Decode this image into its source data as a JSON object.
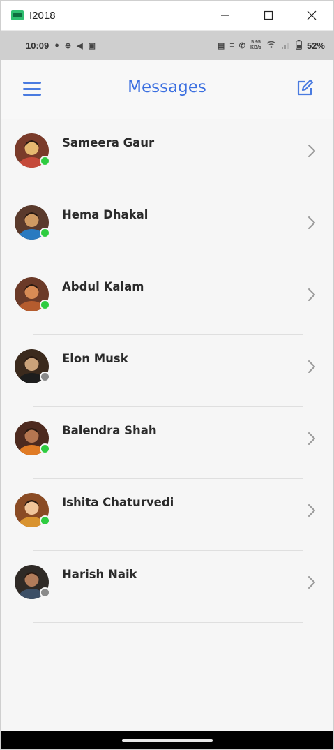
{
  "window": {
    "title": "I2018"
  },
  "status_bar": {
    "time": "10:09",
    "battery": "52%",
    "net_speed": "5.95 KB/s"
  },
  "header": {
    "title": "Messages"
  },
  "contacts": [
    {
      "name": "Sameera Gaur",
      "online": true,
      "avatar_colors": [
        "#7a3b2a",
        "#e6b870",
        "#c54a3a"
      ]
    },
    {
      "name": "Hema Dhakal",
      "online": true,
      "avatar_colors": [
        "#5a3a2c",
        "#cf9a62",
        "#2a7ac0"
      ]
    },
    {
      "name": "Abdul Kalam",
      "online": true,
      "avatar_colors": [
        "#6b3a28",
        "#d88b55",
        "#b55c2e"
      ]
    },
    {
      "name": "Elon Musk",
      "online": false,
      "avatar_colors": [
        "#3b2a1d",
        "#caa27a",
        "#1d1d1d"
      ]
    },
    {
      "name": "Balendra Shah",
      "online": true,
      "avatar_colors": [
        "#4d2a1f",
        "#b57651",
        "#e07b25"
      ]
    },
    {
      "name": "Ishita Chaturvedi",
      "online": true,
      "avatar_colors": [
        "#8a4b24",
        "#f0c59a",
        "#d9932f"
      ]
    },
    {
      "name": "Harish Naik",
      "online": false,
      "avatar_colors": [
        "#2f2a26",
        "#b27c5a",
        "#3c4f66"
      ]
    }
  ],
  "colors": {
    "accent": "#3b6fe0",
    "online": "#2ecc40",
    "offline": "#8a8a8a"
  }
}
